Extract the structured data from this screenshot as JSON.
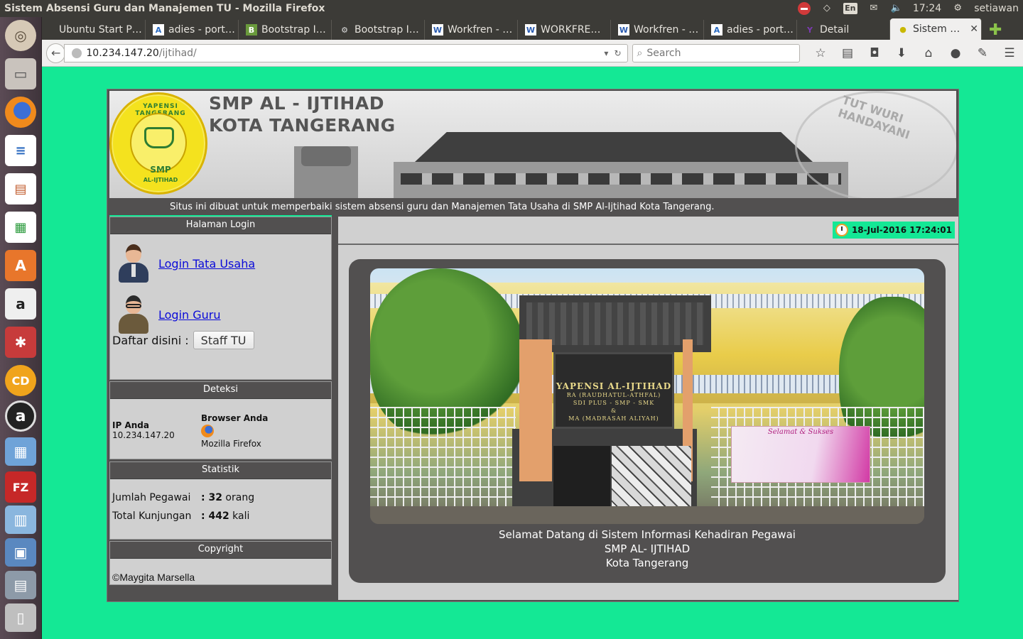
{
  "system": {
    "window_title": "Sistem Absensi Guru dan Manajemen TU - Mozilla Firefox",
    "language": "En",
    "time": "17:24",
    "user": "setiawan"
  },
  "launcher": {
    "items": [
      "dash-home",
      "files",
      "firefox",
      "libreoffice-writer",
      "libreoffice-impress",
      "libreoffice-calc",
      "ubuntu-software",
      "amazon",
      "system-settings",
      "cd-burner",
      "audacious",
      "workspaces",
      "filezilla",
      "trash"
    ]
  },
  "tabs": [
    {
      "label": "Ubuntu Start P…",
      "icon": ""
    },
    {
      "label": "adies - port…",
      "icon": "A"
    },
    {
      "label": "Bootstrap I…",
      "icon": "B"
    },
    {
      "label": "Bootstrap I…",
      "icon": "⚙"
    },
    {
      "label": "Workfren - …",
      "icon": "W"
    },
    {
      "label": "WORKFRE…",
      "icon": "W"
    },
    {
      "label": "Workfren - …",
      "icon": "W"
    },
    {
      "label": "adies - port…",
      "icon": "A"
    },
    {
      "label": "Detail",
      "icon": "Y"
    },
    {
      "label": "Sistem …",
      "icon": "●"
    }
  ],
  "navbar": {
    "url_host": "10.234.147.20",
    "url_path": "/ijtihad/",
    "search_placeholder": "Search"
  },
  "header": {
    "title_line1": "SMP AL - IJTIHAD",
    "title_line2": "KOTA TANGERANG",
    "logo_top": "YAPENSI TANGERANG",
    "logo_smp": "SMP",
    "logo_bottom": "AL-IJTIHAD",
    "seal_text": "TUT WURI HANDAYANI",
    "info_text": "Situs ini dibuat untuk memperbaiki sistem absensi guru dan Manajemen Tata Usaha di SMP Al-Ijtihad Kota Tangerang."
  },
  "sidebar": {
    "login": {
      "heading": "Halaman Login",
      "tata_usaha": "Login Tata Usaha",
      "guru": "Login Guru",
      "daftar_label": "Daftar disini :",
      "staff_button": "Staff TU"
    },
    "deteksi": {
      "heading": "Deteksi",
      "ip_label": "IP Anda",
      "ip_value": "10.234.147.20",
      "browser_label": "Browser Anda",
      "browser_value": "Mozilla Firefox"
    },
    "statistik": {
      "heading": "Statistik",
      "pegawai_label": "Jumlah Pegawai",
      "pegawai_value": ": 32",
      "pegawai_unit": " orang",
      "kunjungan_label": "Total Kunjungan",
      "kunjungan_value": ": 442",
      "kunjungan_unit": " kali"
    },
    "copyright": {
      "heading": "Copyright",
      "text": "©Maygita Marsella"
    }
  },
  "main": {
    "datetime": "18-Jul-2016 17:24:01",
    "photo_sign": {
      "line1": "YAPENSI AL-IJTIHAD",
      "line2": "RA (RAUDHATUL-ATHFAL)",
      "line3": "SDI PLUS - SMP - SMK",
      "line4": "&",
      "line5": "MA (MADRASAH ALIYAH)"
    },
    "photo_banner": "Selamat & Sukses",
    "welcome_line1": "Selamat Datang di Sistem Informasi Kehadiran Pegawai",
    "welcome_line2": "SMP AL- IJTIHAD",
    "welcome_line3": "Kota Tangerang"
  }
}
